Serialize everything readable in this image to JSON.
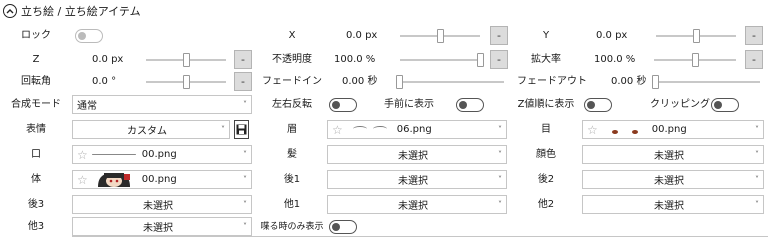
{
  "section": {
    "title": "立ち絵 / 立ち絵アイテム"
  },
  "lock": {
    "label": "ロック"
  },
  "x": {
    "label": "X",
    "value": "0.0 px",
    "slider_level": 0.5
  },
  "y": {
    "label": "Y",
    "value": "0.0 px",
    "slider_level": 0.5
  },
  "z": {
    "label": "Z",
    "value": "0.0 px",
    "slider_level": 0.5
  },
  "opacity": {
    "label": "不透明度",
    "value": "100.0 %",
    "slider_level": 1.0
  },
  "scale": {
    "label": "拡大率",
    "value": "100.0 %",
    "slider_level": 0.5
  },
  "rotation": {
    "label": "回転角",
    "value": "0.0 °",
    "slider_level": 0.5
  },
  "fade_in": {
    "label": "フェードイン",
    "value": "0.00 秒",
    "slider_level": 0.0
  },
  "fade_out": {
    "label": "フェードアウト",
    "value": "0.00 秒",
    "slider_level": 0.0
  },
  "blend": {
    "label": "合成モード",
    "value": "通常"
  },
  "flip": {
    "label": "左右反転"
  },
  "front": {
    "label": "手前に表示"
  },
  "zorder": {
    "label": "Z値順に表示"
  },
  "clipping": {
    "label": "クリッピング"
  },
  "expression": {
    "label": "表情",
    "value": "カスタム"
  },
  "eyebrow": {
    "label": "眉",
    "value": "06.png"
  },
  "eye": {
    "label": "目",
    "value": "00.png"
  },
  "mouth": {
    "label": "口",
    "value": "00.png"
  },
  "hair": {
    "label": "髪",
    "value": "未選択"
  },
  "face_color": {
    "label": "顔色",
    "value": "未選択"
  },
  "body": {
    "label": "体",
    "value": "00.png"
  },
  "back1": {
    "label": "後1",
    "value": "未選択"
  },
  "back2": {
    "label": "後2",
    "value": "未選択"
  },
  "back3": {
    "label": "後3",
    "value": "未選択"
  },
  "other1": {
    "label": "他1",
    "value": "未選択"
  },
  "other2": {
    "label": "他2",
    "value": "未選択"
  },
  "other3": {
    "label": "他3",
    "value": "未選択"
  },
  "speaking_only": {
    "label": "喋る時のみ表示"
  },
  "minus_label": "-",
  "dropdown_glyph": "˅",
  "icons": {
    "collapse": "chevron-up-icon",
    "star": "star-icon",
    "save": "save-icon"
  },
  "colors": {
    "button_bg": "#dcdcdc",
    "border": "#c6c6c6",
    "toggle": "#555555"
  }
}
